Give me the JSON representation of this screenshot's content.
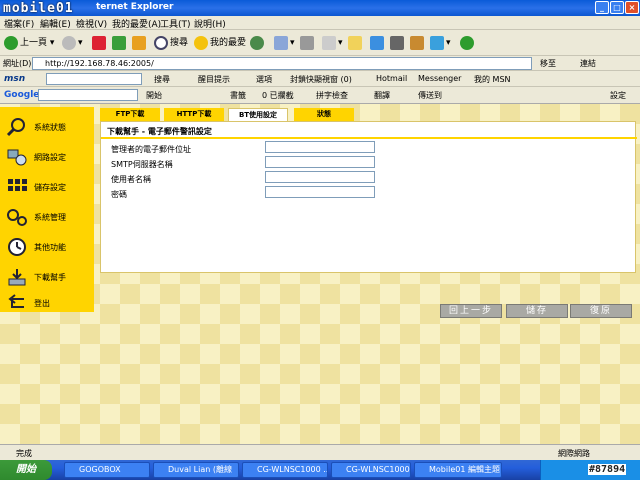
{
  "window": {
    "title": "ternet Explorer",
    "brand": "mobile01"
  },
  "menu": [
    "檔案(F)",
    "編輯(E)",
    "檢視(V)",
    "我的最愛(A)",
    "工具(T)",
    "說明(H)"
  ],
  "toolbar": {
    "back": "上一頁",
    "search": "搜尋",
    "favorites": "我的最愛"
  },
  "address": {
    "label": "網址(D)",
    "url": "http://192.168.78.46:2005/",
    "go": "移至",
    "links": "連結"
  },
  "msnbar": {
    "logo": "msn",
    "search": "搜尋",
    "highlight": "醒目提示",
    "options": "選項",
    "popup": "封鎖快顯視窗 (0)",
    "hotmail": "Hotmail",
    "messenger": "Messenger",
    "mymsn": "我的 MSN"
  },
  "googlebar": {
    "logo": "Google",
    "start": "開始",
    "bookmarks": "書籤",
    "blocked": "0 已攔截",
    "spell": "拼字檢查",
    "translate": "翻譯",
    "sendto": "傳送到",
    "settings": "設定"
  },
  "sidebar": [
    {
      "label": "系統狀態",
      "icon": "magnifier-icon"
    },
    {
      "label": "網路設定",
      "icon": "network-icon"
    },
    {
      "label": "儲存設定",
      "icon": "storage-grid-icon"
    },
    {
      "label": "系統管理",
      "icon": "gears-icon"
    },
    {
      "label": "其他功能",
      "icon": "clock-icon"
    },
    {
      "label": "下載幫手",
      "icon": "download-icon"
    },
    {
      "label": "登出",
      "icon": "logout-arrow-icon"
    }
  ],
  "tabs": [
    "FTP下載",
    "HTTP下載",
    "BT使用設定",
    "狀態"
  ],
  "panel": {
    "title": "下載幫手 - 電子郵件警訊設定",
    "fields": [
      {
        "label": "管理者的電子郵件位址",
        "value": ""
      },
      {
        "label": "SMTP伺服器名稱",
        "value": ""
      },
      {
        "label": "使用者名稱",
        "value": ""
      },
      {
        "label": "密碼",
        "value": ""
      }
    ]
  },
  "actions": {
    "prev": "回上一步",
    "save": "儲存",
    "restore": "復原"
  },
  "status": {
    "text": "完成",
    "zone": "網際網路"
  },
  "taskbar": {
    "start": "開始",
    "items": [
      "GOGOBOX",
      "Duval Lian (離線",
      "CG-WLNSC1000 ...",
      "CG-WLNSC1000...",
      "Mobile01 編輯主題"
    ]
  },
  "watermark": "#87894"
}
